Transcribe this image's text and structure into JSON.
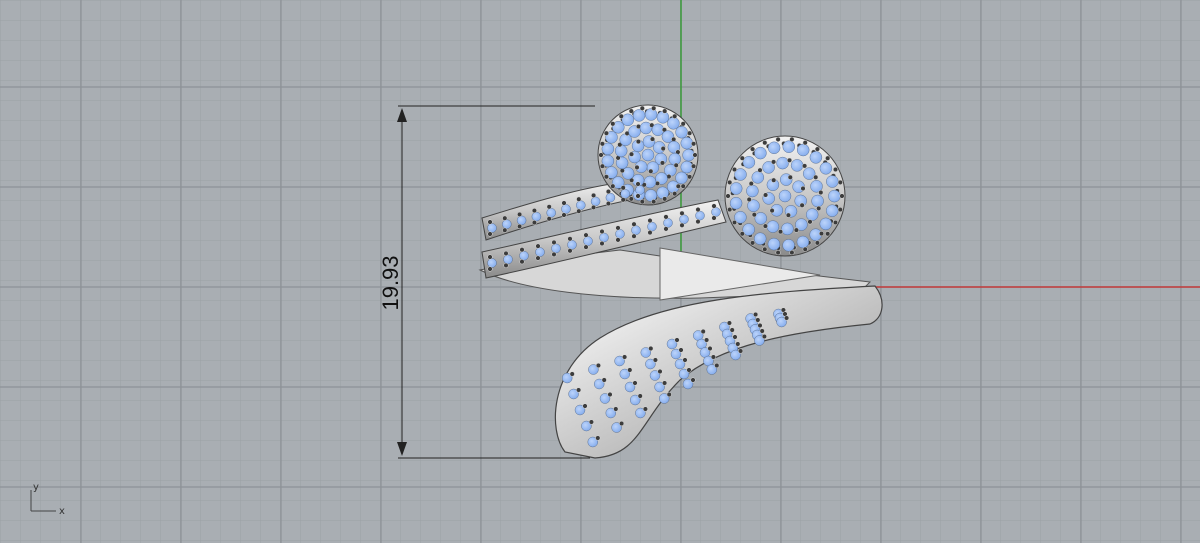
{
  "viewport": {
    "dimension": {
      "value": "19.93"
    },
    "axes": {
      "x_label": "x",
      "y_label": "y"
    },
    "colors": {
      "background": "#a9aeb3",
      "grid_minor": "#9ca1a6",
      "grid_major": "#8d9297",
      "x_axis": "#c23a3a",
      "y_axis": "#3a9a3a",
      "metal": "#c8c8c8",
      "gem": "#8fb4ef",
      "prong": "#3c3c3c"
    },
    "icons": [
      "axis-gizmo-icon"
    ]
  }
}
